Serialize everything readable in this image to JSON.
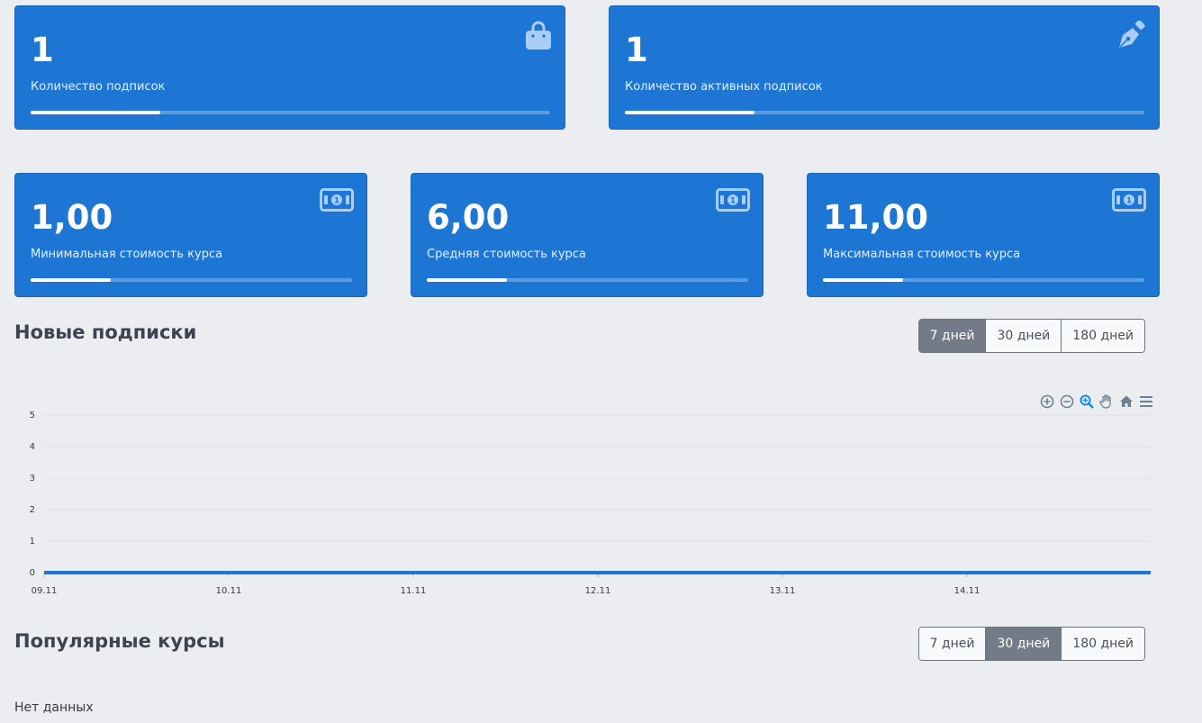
{
  "stats_top": [
    {
      "value": "1",
      "label": "Количество подписок",
      "icon": "shopping-bag-icon",
      "progress": 0.25
    },
    {
      "value": "1",
      "label": "Количество активных подписок",
      "icon": "pen-nib-icon",
      "progress": 0.25
    }
  ],
  "stats_bottom": [
    {
      "value": "1,00",
      "label": "Минимальная стоимость курса",
      "icon": "money-bill-icon",
      "progress": 0.25
    },
    {
      "value": "6,00",
      "label": "Средняя стоимость курса",
      "icon": "money-bill-icon",
      "progress": 0.25
    },
    {
      "value": "11,00",
      "label": "Максимальная стоимость курса",
      "icon": "money-bill-icon",
      "progress": 0.25
    }
  ],
  "new_subscriptions": {
    "title": "Новые подписки",
    "periods": [
      "7 дней",
      "30 дней",
      "180 дней"
    ],
    "active_period": "7 дней"
  },
  "chart_toolbar": [
    "zoom-in-icon",
    "zoom-out-icon",
    "selection-zoom-icon",
    "pan-hand-icon",
    "reset-home-icon",
    "menu-icon"
  ],
  "chart_data": {
    "type": "line",
    "x": [
      "09.11",
      "10.11",
      "11.11",
      "12.11",
      "13.11",
      "14.11",
      "15.11"
    ],
    "x_tick_labels": [
      "09.11",
      "10.11",
      "11.11",
      "12.11",
      "13.11",
      "14.11"
    ],
    "series": [
      {
        "values": [
          0,
          0,
          0,
          0,
          0,
          0,
          0
        ]
      }
    ],
    "ylim": [
      0,
      5
    ],
    "y_ticks": [
      "5",
      "4",
      "3",
      "2",
      "1",
      "0"
    ],
    "grid": true,
    "color": "#1d76d4"
  },
  "popular_courses": {
    "title": "Популярные курсы",
    "periods": [
      "7 дней",
      "30 дней",
      "180 дней"
    ],
    "active_period": "30 дней",
    "empty_text": "Нет данных"
  },
  "colors": {
    "card": "#1d76d4",
    "active_button": "#737b88",
    "background": "#ebedf0"
  }
}
